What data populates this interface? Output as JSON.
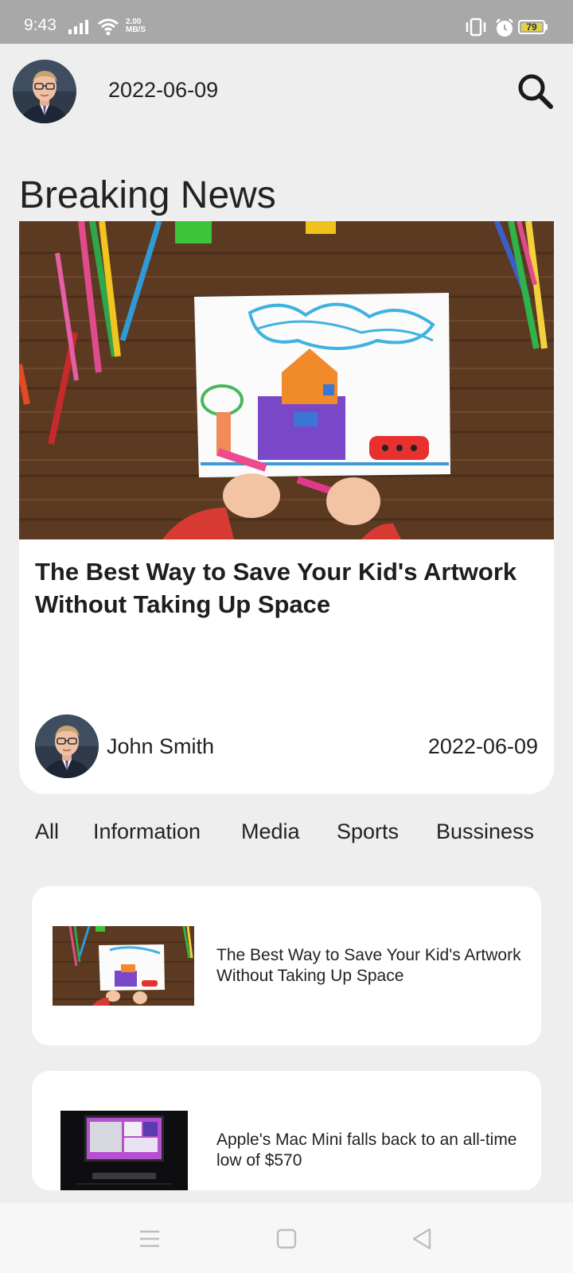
{
  "status_bar": {
    "time": "9:43",
    "net_speed_value": "2.00",
    "net_speed_unit": "MB/S",
    "battery_level": "79",
    "icons": [
      "signal-icon",
      "wifi-icon",
      "vibrate-icon",
      "alarm-icon",
      "battery-icon"
    ]
  },
  "header": {
    "date": "2022-06-09",
    "avatar": "profile-avatar",
    "search_icon": "search-icon"
  },
  "section_title": "Breaking News",
  "breaking": {
    "title": "The Best Way to Save Your Kid's Artwork Without Taking Up Space",
    "author": "John Smith",
    "date": "2022-06-09",
    "image": "kids-drawing-on-wooden-table"
  },
  "tabs": [
    "All",
    "Information",
    "Media",
    "Sports",
    "Bussiness"
  ],
  "news": [
    {
      "title": "The Best Way to Save Your Kid's Artwork Without Taking Up Space",
      "thumb": "kids-drawing-thumbnail"
    },
    {
      "title": "Apple's Mac Mini falls back to an all-time low of $570",
      "thumb": "mac-mini-thumbnail"
    }
  ],
  "nav_bar": {
    "icons": [
      "menu-icon",
      "home-icon",
      "back-icon"
    ]
  },
  "colors": {
    "background": "#eeeeee",
    "card": "#ffffff",
    "status_bar": "#a8a8a8",
    "battery": "#e3d04b",
    "text": "#222222"
  }
}
